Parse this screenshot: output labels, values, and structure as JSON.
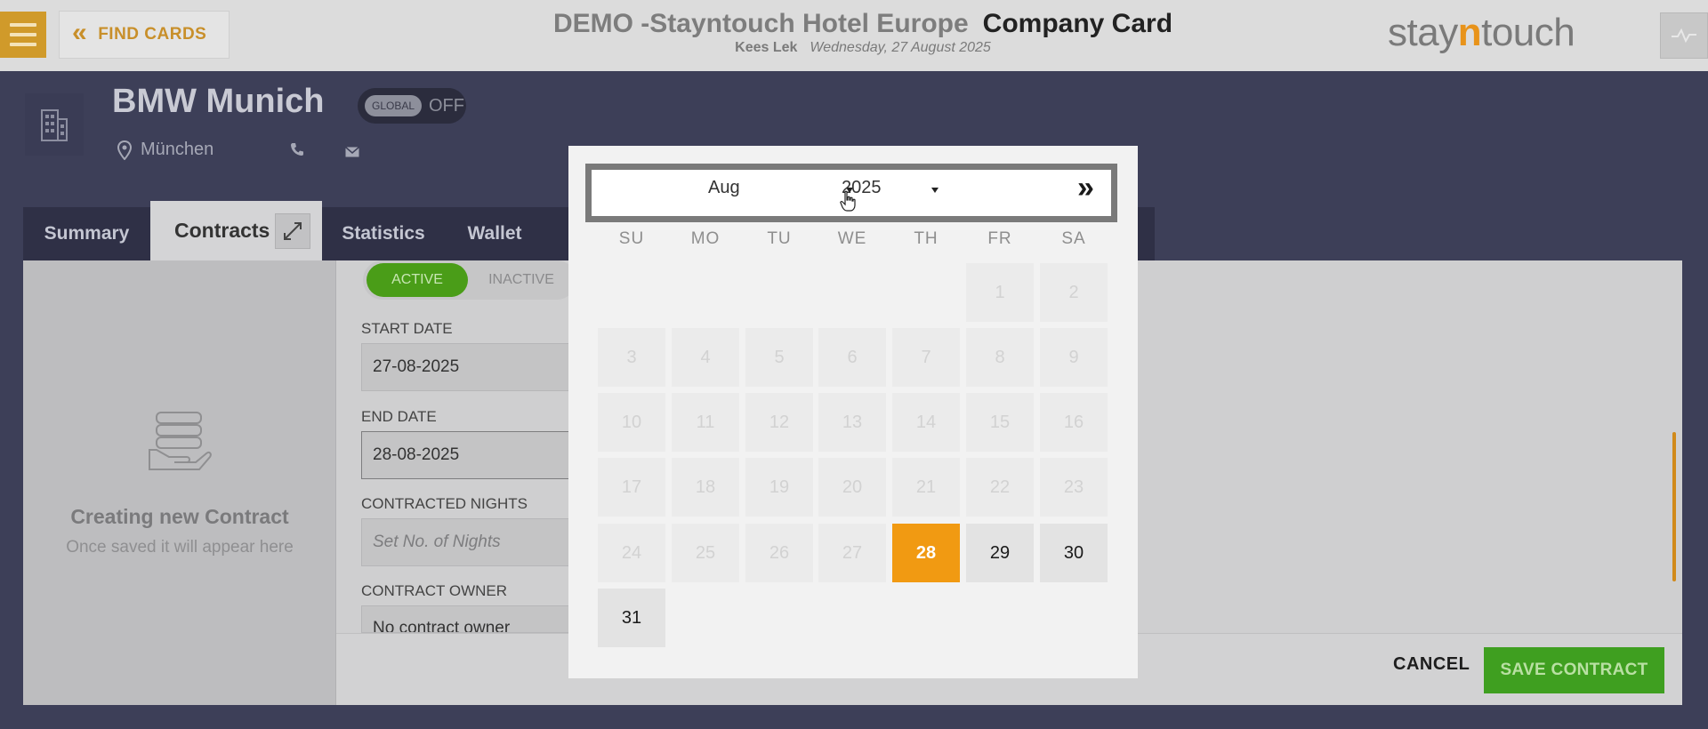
{
  "header": {
    "menu_icon": "hamburger-icon",
    "find_cards_label": "FIND CARDS",
    "hotel_name": "DEMO -Stayntouch Hotel Europe",
    "page_title": "Company Card",
    "user_name": "Kees Lek",
    "business_date": "Wednesday, 27 August 2025",
    "logo_pre": "stay",
    "logo_n": "n",
    "logo_post": "touch",
    "activity_icon": "pulse-icon"
  },
  "company": {
    "name": "BMW Munich",
    "global_label": "GLOBAL",
    "global_state": "OFF",
    "city": "München",
    "icons": [
      "building-icon",
      "location-pin-icon",
      "phone-icon",
      "mail-icon"
    ]
  },
  "tabs": [
    {
      "label": "Summary",
      "active": false
    },
    {
      "label": "Contracts",
      "active": true
    },
    {
      "label": "Statistics",
      "active": false
    },
    {
      "label": "Wallet",
      "active": false
    }
  ],
  "contract_panel": {
    "title": "Creating new Contract",
    "subtitle": "Once saved it will appear here"
  },
  "form": {
    "status_active": "ACTIVE",
    "status_inactive": "INACTIVE",
    "start_date_label": "START DATE",
    "start_date_value": "27-08-2025",
    "end_date_label": "END DATE",
    "end_date_value": "28-08-2025",
    "nights_label": "CONTRACTED NIGHTS",
    "nights_placeholder": "Set No. of Nights",
    "owner_label": "CONTRACT OWNER",
    "owner_value": "No contract owner"
  },
  "footer": {
    "cancel_label": "CANCEL",
    "save_label": "SAVE CONTRACT"
  },
  "datepicker": {
    "month": "Aug",
    "year": "2025",
    "next_icon": "double-chevron-right-icon",
    "weekdays": [
      "SU",
      "MO",
      "TU",
      "WE",
      "TH",
      "FR",
      "SA"
    ],
    "days": [
      {
        "day": "1",
        "state": "disabled"
      },
      {
        "day": "2",
        "state": "disabled"
      },
      {
        "day": "3",
        "state": "disabled"
      },
      {
        "day": "4",
        "state": "disabled"
      },
      {
        "day": "5",
        "state": "disabled"
      },
      {
        "day": "6",
        "state": "disabled"
      },
      {
        "day": "7",
        "state": "disabled"
      },
      {
        "day": "8",
        "state": "disabled"
      },
      {
        "day": "9",
        "state": "disabled"
      },
      {
        "day": "10",
        "state": "disabled"
      },
      {
        "day": "11",
        "state": "disabled"
      },
      {
        "day": "12",
        "state": "disabled"
      },
      {
        "day": "13",
        "state": "disabled"
      },
      {
        "day": "14",
        "state": "disabled"
      },
      {
        "day": "15",
        "state": "disabled"
      },
      {
        "day": "16",
        "state": "disabled"
      },
      {
        "day": "17",
        "state": "disabled"
      },
      {
        "day": "18",
        "state": "disabled"
      },
      {
        "day": "19",
        "state": "disabled"
      },
      {
        "day": "20",
        "state": "disabled"
      },
      {
        "day": "21",
        "state": "disabled"
      },
      {
        "day": "22",
        "state": "disabled"
      },
      {
        "day": "23",
        "state": "disabled"
      },
      {
        "day": "24",
        "state": "disabled"
      },
      {
        "day": "25",
        "state": "disabled"
      },
      {
        "day": "26",
        "state": "disabled"
      },
      {
        "day": "27",
        "state": "disabled"
      },
      {
        "day": "28",
        "state": "selected"
      },
      {
        "day": "29",
        "state": "enabled"
      },
      {
        "day": "30",
        "state": "enabled"
      },
      {
        "day": "31",
        "state": "enabled"
      }
    ]
  }
}
